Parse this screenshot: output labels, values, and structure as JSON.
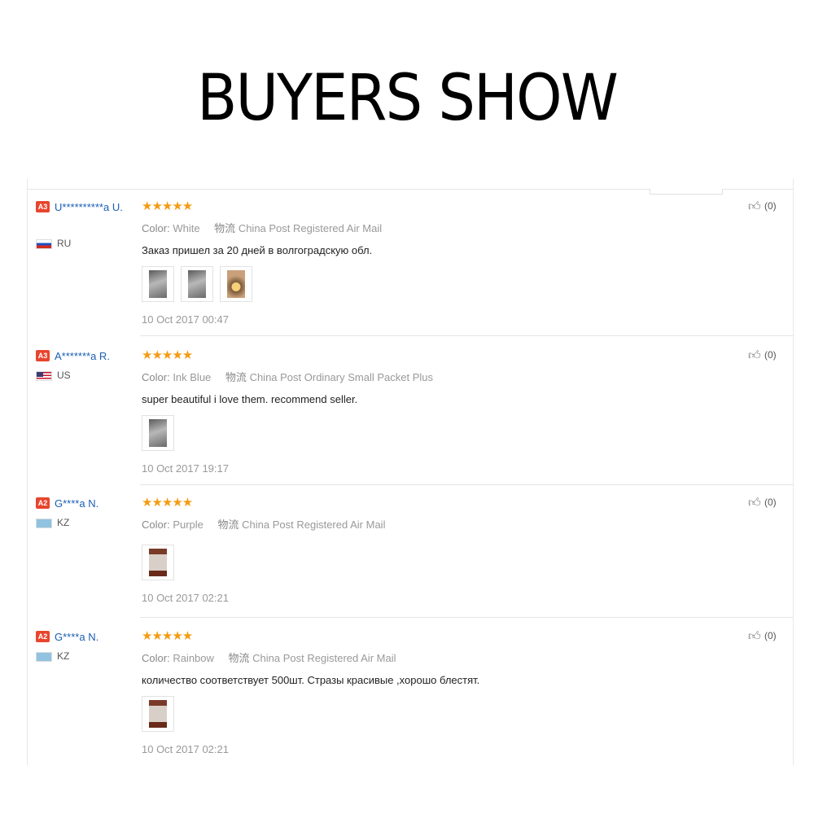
{
  "banner": {
    "title": "BUYERS SHOW"
  },
  "reviews": [
    {
      "level": "A3",
      "user": "U**********a U.",
      "country": "RU",
      "stars": "★★★★★",
      "color_label": "Color:",
      "color": "White",
      "logistics_label": "物流",
      "shipping": "China Post Registered Air Mail",
      "text": "Заказ пришел за 20 дней в волгоградскую обл.",
      "photos": 3,
      "date": "10 Oct 2017 00:47",
      "likes": "(0)"
    },
    {
      "level": "A3",
      "user": "A*******a R.",
      "country": "US",
      "stars": "★★★★★",
      "color_label": "Color:",
      "color": "Ink Blue",
      "logistics_label": "物流",
      "shipping": "China Post Ordinary Small Packet Plus",
      "text": "super beautiful i love them. recommend seller.",
      "photos": 1,
      "date": "10 Oct 2017 19:17",
      "likes": "(0)"
    },
    {
      "level": "A2",
      "user": "G****a N.",
      "country": "KZ",
      "stars": "★★★★★",
      "color_label": "Color:",
      "color": "Purple",
      "logistics_label": "物流",
      "shipping": "China Post Registered Air Mail",
      "text": "",
      "photos": 1,
      "date": "10 Oct 2017 02:21",
      "likes": "(0)"
    },
    {
      "level": "A2",
      "user": "G****a N.",
      "country": "KZ",
      "stars": "★★★★★",
      "color_label": "Color:",
      "color": "Rainbow",
      "logistics_label": "物流",
      "shipping": "China Post Registered Air Mail",
      "text": "количество соответствует 500шт. Стразы красивые ,хорошо блестят.",
      "photos": 1,
      "date": "10 Oct 2017 02:21",
      "likes": "(0)"
    }
  ],
  "icons": {
    "like": "thumbs-up-icon",
    "star": "star-icon",
    "flag": "country-flag-icon"
  },
  "colors": {
    "username": "#1a5fb4",
    "stars": "#f39c12",
    "level_badge": "#e8452e"
  }
}
